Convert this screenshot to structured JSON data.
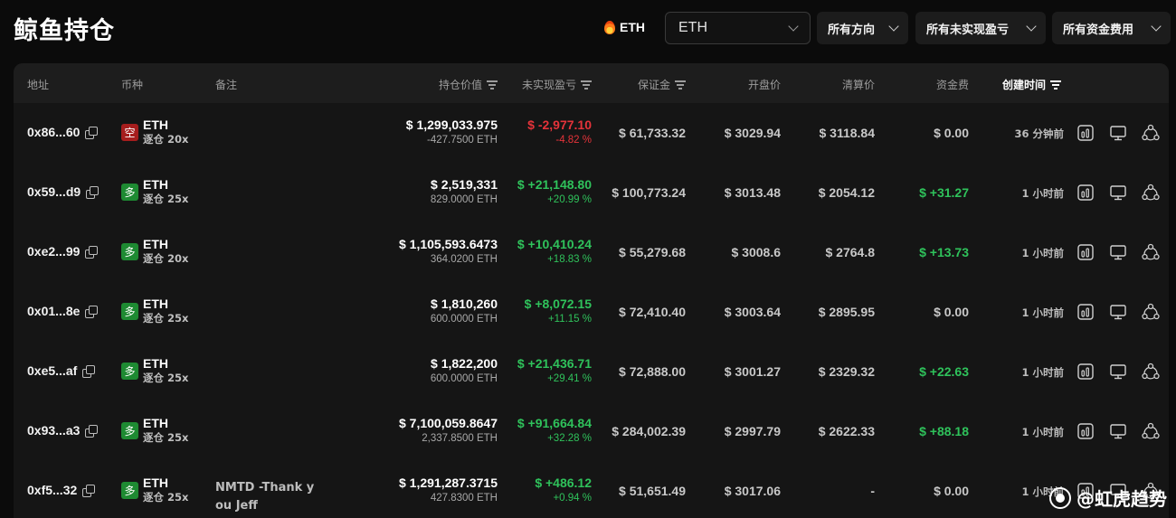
{
  "page": {
    "title": "鲸鱼持仓"
  },
  "hot_asset": {
    "label": "ETH",
    "icon": "fire-icon"
  },
  "filters": {
    "asset_select": {
      "value": "ETH"
    },
    "direction": {
      "value": "所有方向"
    },
    "unrealized_pnl": {
      "value": "所有未实现盈亏"
    },
    "funding_fee": {
      "value": "所有资金费用"
    }
  },
  "table": {
    "columns": {
      "address": "地址",
      "coin": "币种",
      "note": "备注",
      "position_value": "持仓价值",
      "unrealized_pnl": "未实现盈亏",
      "margin": "保证金",
      "entry_price": "开盘价",
      "liq_price": "清算价",
      "funding": "资金费",
      "created": "创建时间"
    },
    "rows": [
      {
        "address": "0x86...60",
        "side": "short",
        "side_label": "空",
        "coin": "ETH",
        "leverage": "逐仓 20x",
        "note": "",
        "value": "$ 1,299,033.975",
        "size": "-427.7500 ETH",
        "pnl": "$ -2,977.10",
        "pnl_pct": "-4.82 %",
        "pnl_dir": "neg",
        "margin": "$ 61,733.32",
        "entry": "$ 3029.94",
        "liq": "$ 3118.84",
        "funding": "$ 0.00",
        "funding_dir": "zero",
        "created": "36 分钟前"
      },
      {
        "address": "0x59...d9",
        "side": "long",
        "side_label": "多",
        "coin": "ETH",
        "leverage": "逐仓 25x",
        "note": "",
        "value": "$ 2,519,331",
        "size": "829.0000 ETH",
        "pnl": "$ +21,148.80",
        "pnl_pct": "+20.99 %",
        "pnl_dir": "pos",
        "margin": "$ 100,773.24",
        "entry": "$ 3013.48",
        "liq": "$ 2054.12",
        "funding": "$ +31.27",
        "funding_dir": "pos",
        "created": "1 小时前"
      },
      {
        "address": "0xe2...99",
        "side": "long",
        "side_label": "多",
        "coin": "ETH",
        "leverage": "逐仓 20x",
        "note": "",
        "value": "$ 1,105,593.6473",
        "size": "364.0200 ETH",
        "pnl": "$ +10,410.24",
        "pnl_pct": "+18.83 %",
        "pnl_dir": "pos",
        "margin": "$ 55,279.68",
        "entry": "$ 3008.6",
        "liq": "$ 2764.8",
        "funding": "$ +13.73",
        "funding_dir": "pos",
        "created": "1 小时前"
      },
      {
        "address": "0x01...8e",
        "side": "long",
        "side_label": "多",
        "coin": "ETH",
        "leverage": "逐仓 25x",
        "note": "",
        "value": "$ 1,810,260",
        "size": "600.0000 ETH",
        "pnl": "$ +8,072.15",
        "pnl_pct": "+11.15 %",
        "pnl_dir": "pos",
        "margin": "$ 72,410.40",
        "entry": "$ 3003.64",
        "liq": "$ 2895.95",
        "funding": "$ 0.00",
        "funding_dir": "zero",
        "created": "1 小时前"
      },
      {
        "address": "0xe5...af",
        "side": "long",
        "side_label": "多",
        "coin": "ETH",
        "leverage": "逐仓 25x",
        "note": "",
        "value": "$ 1,822,200",
        "size": "600.0000 ETH",
        "pnl": "$ +21,436.71",
        "pnl_pct": "+29.41 %",
        "pnl_dir": "pos",
        "margin": "$ 72,888.00",
        "entry": "$ 3001.27",
        "liq": "$ 2329.32",
        "funding": "$ +22.63",
        "funding_dir": "pos",
        "created": "1 小时前"
      },
      {
        "address": "0x93...a3",
        "side": "long",
        "side_label": "多",
        "coin": "ETH",
        "leverage": "逐仓 25x",
        "note": "",
        "value": "$ 7,100,059.8647",
        "size": "2,337.8500 ETH",
        "pnl": "$ +91,664.84",
        "pnl_pct": "+32.28 %",
        "pnl_dir": "pos",
        "margin": "$ 284,002.39",
        "entry": "$ 2997.79",
        "liq": "$ 2622.33",
        "funding": "$ +88.18",
        "funding_dir": "pos",
        "created": "1 小时前"
      },
      {
        "address": "0xf5...32",
        "side": "long",
        "side_label": "多",
        "coin": "ETH",
        "leverage": "逐仓 25x",
        "note": "NMTD -Thank you Jeff",
        "value": "$ 1,291,287.3715",
        "size": "427.8300 ETH",
        "pnl": "$ +486.12",
        "pnl_pct": "+0.94 %",
        "pnl_dir": "pos",
        "margin": "$ 51,651.49",
        "entry": "$ 3017.06",
        "liq": "-",
        "funding": "$ 0.00",
        "funding_dir": "zero",
        "created": "1 小时前"
      }
    ]
  },
  "row_action_icons": [
    "bar-chart-icon",
    "monitor-icon",
    "share-icon"
  ],
  "watermark": {
    "text": "@虹虎趋势"
  },
  "colors": {
    "positive": "#2fc25b",
    "negative": "#e5333a",
    "short_badge": "#a61d1d",
    "long_badge": "#1e8a32",
    "background": "#0b0b0b"
  }
}
